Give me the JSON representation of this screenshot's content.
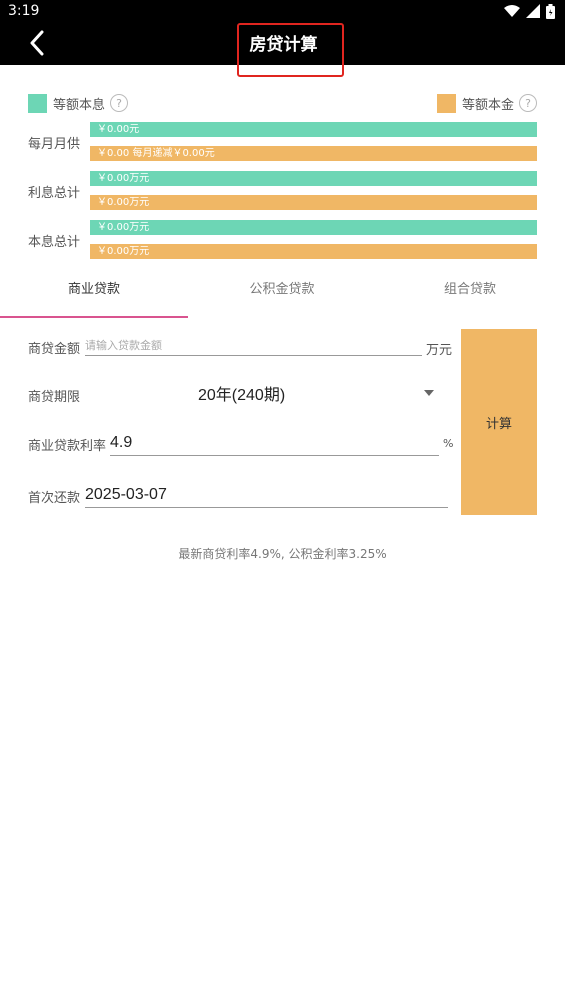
{
  "status_bar": {
    "time": "3:19",
    "icons": [
      "wifi-icon",
      "signal-icon",
      "battery-icon"
    ]
  },
  "header": {
    "title": "房贷计算",
    "back_icon": "back-arrow-icon"
  },
  "legend": {
    "equal_installment": {
      "label": "等额本息",
      "color": "#6dd6b5",
      "help": "?"
    },
    "equal_principal": {
      "label": "等额本金",
      "color": "#f0b765",
      "help": "?"
    }
  },
  "summary": {
    "monthly": {
      "label": "每月月供",
      "equal_installment": "￥0.00元",
      "equal_principal": "￥0.00 每月递减￥0.00元"
    },
    "interest": {
      "label": "利息总计",
      "equal_installment": "￥0.00万元",
      "equal_principal": "￥0.00万元"
    },
    "total": {
      "label": "本息总计",
      "equal_installment": "￥0.00万元",
      "equal_principal": "￥0.00万元"
    }
  },
  "tabs": [
    {
      "label": "商业贷款",
      "active": true
    },
    {
      "label": "公积金贷款",
      "active": false
    },
    {
      "label": "组合贷款",
      "active": false
    }
  ],
  "form": {
    "amount": {
      "label": "商贷金额",
      "placeholder": "请输入贷款金额",
      "value": "",
      "unit": "万元"
    },
    "term": {
      "label": "商贷期限",
      "value": "20年(240期)"
    },
    "rate": {
      "label": "商业贷款利率",
      "value": "4.9",
      "unit": "%"
    },
    "first_payment": {
      "label": "首次还款",
      "value": "2025-03-07"
    },
    "calculate_label": "计算"
  },
  "footnote": "最新商贷利率4.9%, 公积金利率3.25%",
  "colors": {
    "accent_tab": "#d9548f",
    "title_highlight": "#e0251f"
  }
}
